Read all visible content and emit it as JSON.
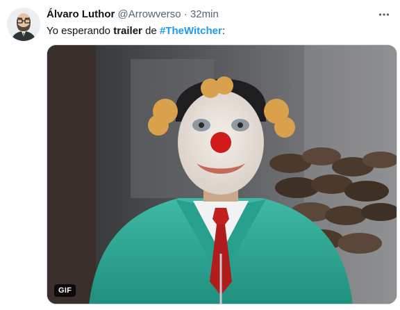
{
  "tweet": {
    "display_name": "Álvaro Luthor",
    "handle": "@Arrowverso",
    "separator": "·",
    "time": "32min",
    "text_prefix": "Yo esperando ",
    "text_bold": "trailer",
    "text_mid": " de ",
    "hashtag": "#TheWitcher",
    "text_suffix": ":",
    "more_icon": "more-horizontal-icon"
  },
  "media": {
    "badge": "GIF"
  },
  "colors": {
    "accent": "#1d9bf0",
    "secondary_text": "#536471",
    "primary_text": "#0f1419"
  }
}
